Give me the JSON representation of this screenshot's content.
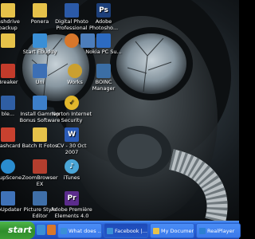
{
  "desktop_icons": [
    {
      "label": "lashdrive\nbackup",
      "icon": "folder-icon",
      "color": "#e6c24a"
    },
    {
      "label": "Ponera",
      "icon": "folder-icon",
      "color": "#e6c24a"
    },
    {
      "label": "Digital Photo\nProfessional",
      "icon": "camera-app-icon",
      "color": "#2b5aa8"
    },
    {
      "label": "Adobe\nPhotosho...",
      "icon": "photoshop-icon",
      "color": "#1c3f7a"
    },
    {
      "label": "",
      "icon": "folder-icon",
      "color": "#e6c24a"
    },
    {
      "label": "Start Ebuddy",
      "icon": "ebuddy-icon",
      "color": "#3a8fd6"
    },
    {
      "label": "",
      "icon": "firefox-icon",
      "color": "#d8772b"
    },
    {
      "label": "",
      "icon": "app-icon",
      "color": "#4c7dbb"
    },
    {
      "label": "Nokia PC Su...",
      "icon": "nokia-icon",
      "color": "#2c6bc2"
    },
    {
      "label": "Breaker",
      "icon": "app-icon",
      "color": "#c23b2b"
    },
    {
      "label": "Uni",
      "icon": "app-icon",
      "color": "#3c6fb5"
    },
    {
      "label": "Works",
      "icon": "app-icon",
      "color": "#caa030"
    },
    {
      "label": "BOINC\nManager",
      "icon": "boinc-icon",
      "color": "#3b6ea5"
    },
    {
      "label": "ble...",
      "icon": "app-icon",
      "color": "#2f5ea3"
    },
    {
      "label": "Install Gamnap\nBonus Software",
      "icon": "installer-icon",
      "color": "#3d7fc9"
    },
    {
      "label": "Norton Internet\nSecurity",
      "icon": "norton-icon",
      "color": "#e2b72c"
    },
    {
      "label": "Flashcard",
      "icon": "flashcard-icon",
      "color": "#c8412f"
    },
    {
      "label": "Batch It Fotos",
      "icon": "folder-icon",
      "color": "#e6c24a"
    },
    {
      "label": "CV - 30 Oct\n2007",
      "icon": "word-document-icon",
      "color": "#2a5bb7"
    },
    {
      "label": "...upScene",
      "icon": "app-icon",
      "color": "#2a8ccf"
    },
    {
      "label": "ZoomBrowser\nEX",
      "icon": "zoombrowser-icon",
      "color": "#b43e2e"
    },
    {
      "label": "iTunes",
      "icon": "itunes-icon",
      "color": "#4aa6d8"
    },
    {
      "label": "ebUpdater",
      "icon": "app-icon",
      "color": "#3f72b8"
    },
    {
      "label": "Picture Style\nEditor",
      "icon": "picture-style-icon",
      "color": "#3f6fa8"
    },
    {
      "label": "Adobe Première\nElements 4.0",
      "icon": "premiere-icon",
      "color": "#5b2c8c"
    }
  ],
  "taskbar": {
    "start_label": "start",
    "tasks": [
      {
        "label": "What does ...",
        "icon": "ie-icon",
        "color": "#3a8fd6",
        "active": false
      },
      {
        "label": "Facebook |...",
        "icon": "ie-icon",
        "color": "#3a8fd6",
        "active": true
      },
      {
        "label": "My Documents",
        "icon": "folder-icon",
        "color": "#e6c24a",
        "active": false
      },
      {
        "label": "RealPlayer",
        "icon": "realplayer-icon",
        "color": "#2c7fd1",
        "active": false
      }
    ]
  }
}
